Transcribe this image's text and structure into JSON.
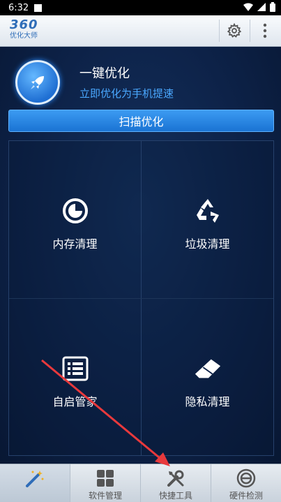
{
  "status_bar": {
    "time": "6:32"
  },
  "app_bar": {
    "logo_number": "360",
    "logo_subtitle": "优化大师",
    "settings_icon": "gear-icon",
    "menu_icon": "more-vertical-icon"
  },
  "hero": {
    "title": "一键优化",
    "subtitle": "立即优化为手机提速",
    "icon": "rocket-icon"
  },
  "scan_button": {
    "label": "扫描优化"
  },
  "features": [
    {
      "label": "内存清理",
      "icon": "memory-icon"
    },
    {
      "label": "垃圾清理",
      "icon": "recycle-icon"
    },
    {
      "label": "自启管家",
      "icon": "list-icon"
    },
    {
      "label": "隐私清理",
      "icon": "eraser-icon"
    }
  ],
  "bottom_nav": [
    {
      "label": "",
      "icon": "magic-wand-icon",
      "active": true
    },
    {
      "label": "软件管理",
      "icon": "apps-icon",
      "active": false
    },
    {
      "label": "快捷工具",
      "icon": "tools-icon",
      "active": false
    },
    {
      "label": "硬件检测",
      "icon": "hardware-icon",
      "active": false
    }
  ],
  "colors": {
    "accent": "#1a73d3",
    "subtitle": "#4aa8ff",
    "arrow": "#e8393c"
  }
}
